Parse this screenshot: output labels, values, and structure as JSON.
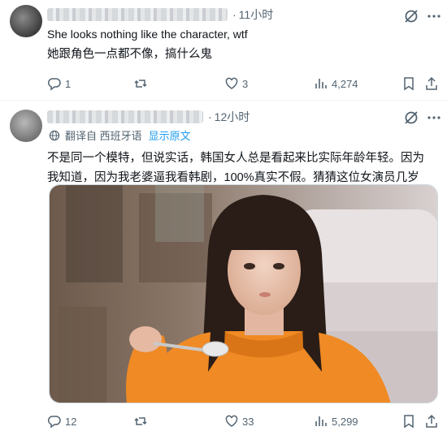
{
  "tweet1": {
    "time": "11小时",
    "text_en": "She looks nothing like the character, wtf",
    "text_zh": "她跟角色一点都不像，搞什么鬼",
    "replies": "1",
    "retweets": "",
    "likes": "3",
    "views": "4,274"
  },
  "tweet2": {
    "time": "12小时",
    "translated_from": "翻译自 西班牙语",
    "show_original": "显示原文",
    "text_zh": "不是同一个模特，但说实话，韩国女人总是看起来比实际年龄年轻。因为我知道，因为我老婆逼我看韩剧，100%真实不假。猜猜这位女演员几岁",
    "replies": "12",
    "retweets": "",
    "likes": "33",
    "views": "5,299"
  },
  "icons": {
    "reply": "reply-icon",
    "retweet": "retweet-icon",
    "like": "heart-icon",
    "views": "views-icon",
    "bookmark": "bookmark-icon",
    "share": "share-icon",
    "grok": "grok-icon",
    "more": "more-icon",
    "translate": "globe-icon"
  },
  "colors": {
    "text": "#0f1419",
    "secondary": "#536471",
    "link": "#1d9bf0",
    "border": "#eff3f4",
    "sweater": "#f08a24"
  }
}
